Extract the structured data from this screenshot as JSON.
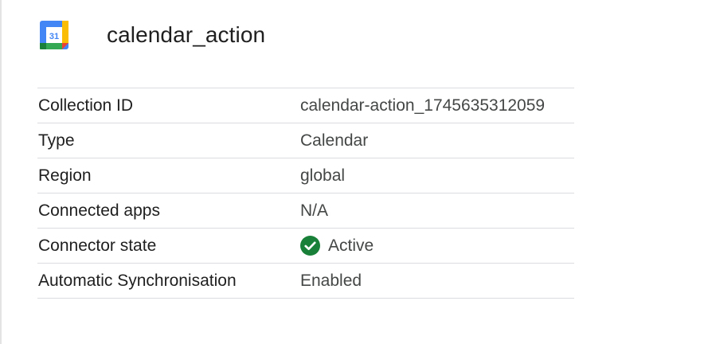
{
  "header": {
    "icon": "google-calendar-icon",
    "icon_text": "31",
    "title": "calendar_action"
  },
  "details": {
    "rows": [
      {
        "label": "Collection ID",
        "value": "calendar-action_1745635312059"
      },
      {
        "label": "Type",
        "value": "Calendar"
      },
      {
        "label": "Region",
        "value": "global"
      },
      {
        "label": "Connected apps",
        "value": "N/A"
      },
      {
        "label": "Connector state",
        "value": "Active",
        "icon": "check-circle-icon"
      },
      {
        "label": "Automatic Synchronisation",
        "value": "Enabled"
      }
    ]
  },
  "colors": {
    "status_active": "#188038",
    "divider": "#dadce0",
    "label_text": "#1f1f1f",
    "value_text": "#444746"
  }
}
